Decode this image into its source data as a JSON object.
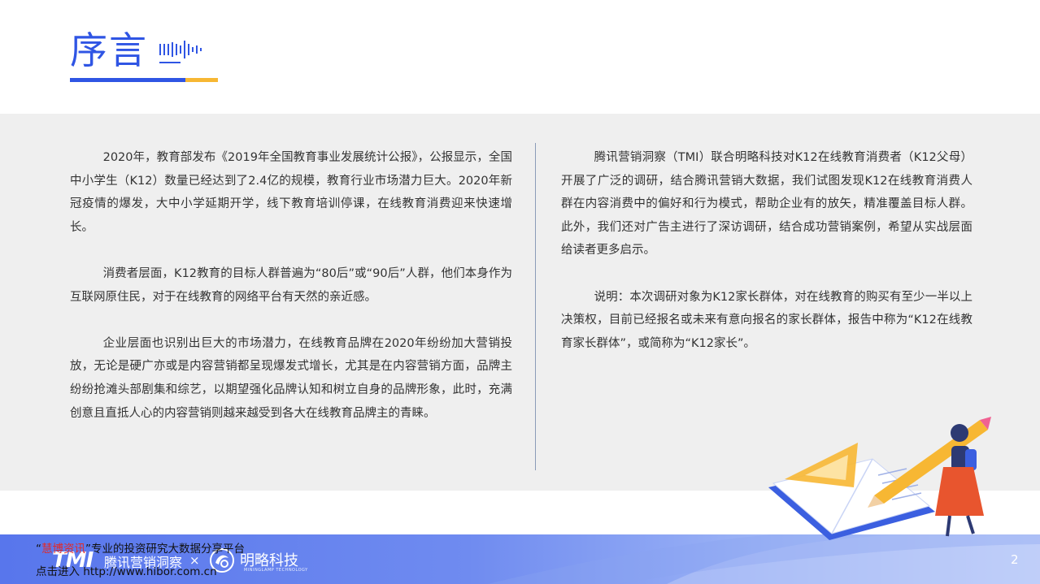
{
  "header": {
    "title": "序言"
  },
  "left_column": {
    "paragraphs": [
      "2020年，教育部发布《2019年全国教育事业发展统计公报》，公报显示，全国中小学生（K12）数量已经达到了2.4亿的规模，教育行业市场潜力巨大。2020年新冠疫情的爆发，大中小学延期开学，线下教育培训停课，在线教育消费迎来快速增长。",
      "消费者层面，K12教育的目标人群普遍为“80后”或“90后”人群，他们本身作为互联网原住民，对于在线教育的网络平台有天然的亲近感。",
      "企业层面也识别出巨大的市场潜力，在线教育品牌在2020年纷纷加大营销投放，无论是硬广亦或是内容营销都呈现爆发式增长，尤其是在内容营销方面，品牌主纷纷抢滩头部剧集和综艺，以期望强化品牌认知和树立自身的品牌形象，此时，充满创意且直抵人心的内容营销则越来越受到各大在线教育品牌主的青睐。"
    ]
  },
  "right_column": {
    "paragraphs": [
      "腾讯营销洞察（TMI）联合明略科技对K12在线教育消费者（K12父母）开展了广泛的调研，结合腾讯营销大数据，我们试图发现K12在线教育消费人群在内容消费中的偏好和行为模式，帮助企业有的放矢，精准覆盖目标人群。此外，我们还对广告主进行了深访调研，结合成功营销案例，希望从实战层面给读者更多启示。",
      "说明：本次调研对象为K12家长群体，对在线教育的购买有至少一半以上决策权，目前已经报名或未来有意向报名的家长群体，报告中称为“K12在线教育家长群体”，或简称为“K12家长”。"
    ]
  },
  "footer": {
    "brand_tmi": "TMI",
    "brand_tencent": "腾讯营销洞察",
    "brand_separator": "×",
    "brand_minglue": "明略科技",
    "brand_minglue_sub": "MININGLAMP TECHNOLOGY",
    "page_number": "2"
  },
  "watermark": {
    "line1_quote_open": "“",
    "line1_name": "慧博资讯",
    "line1_rest": "”专业的投资研究大数据分享平台",
    "line2": "点击进入 http://www.hibor.com.cn"
  },
  "colors": {
    "accent_blue": "#2f55e4",
    "accent_yellow": "#f7b733",
    "band_gray": "#efefef"
  }
}
